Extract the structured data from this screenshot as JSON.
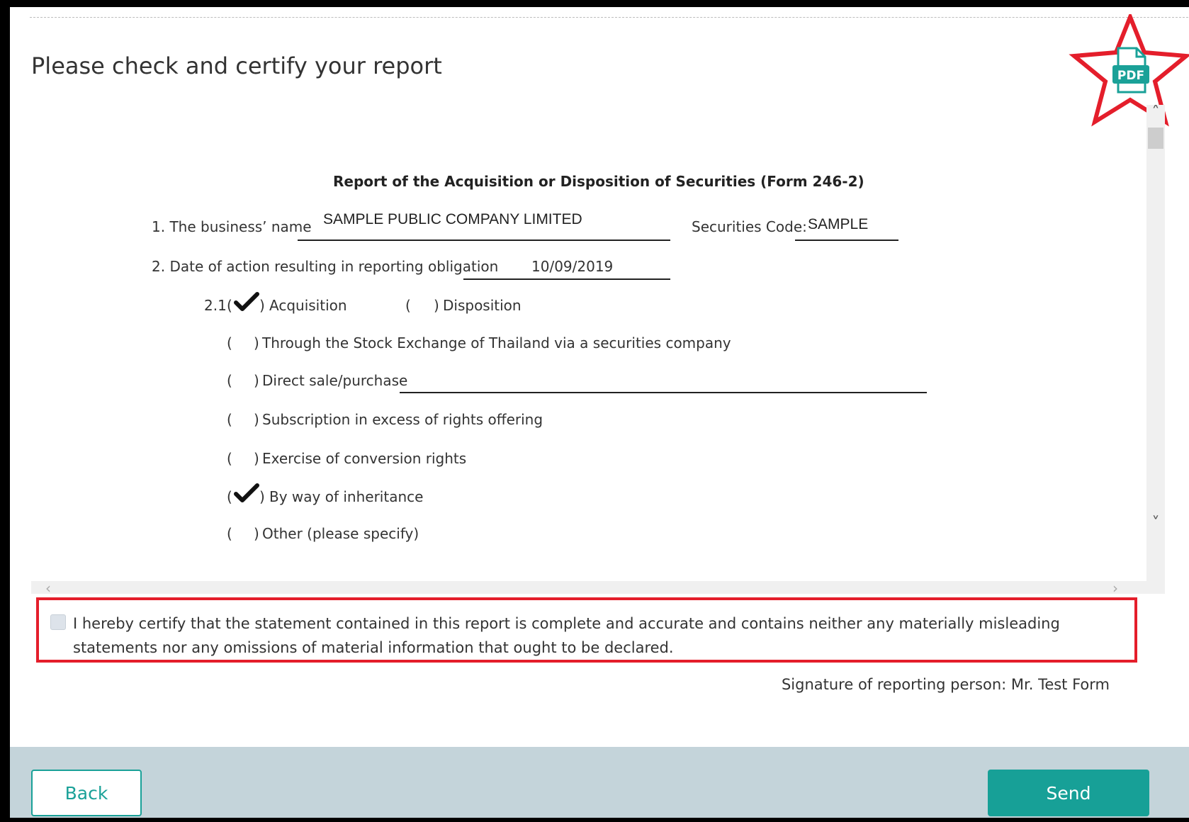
{
  "header": {
    "title": "Please check and certify your report",
    "pdf_label": "PDF",
    "accent_color": "#e41e2b",
    "pdf_icon_color": "#1aa198"
  },
  "report": {
    "title": "Report of the Acquisition or Disposition of Securities (Form 246-2)",
    "business_name_label": "1. The business’ name",
    "business_name_value": "SAMPLE PUBLIC COMPANY LIMITED",
    "securities_code_label": "Securities Code:",
    "securities_code_value": "SAMPLE",
    "date_label": "2. Date of action resulting in reporting obligation",
    "date_value": "10/09/2019",
    "section_number": "2.1",
    "acquisition_label": "Acquisition",
    "disposition_label": "Disposition",
    "acquisition_checked": true,
    "disposition_checked": false,
    "methods": [
      {
        "label": "Through the Stock Exchange of Thailand via a securities company",
        "checked": false
      },
      {
        "label": "Direct sale/purchase",
        "checked": false
      },
      {
        "label": "Subscription in excess of rights offering",
        "checked": false
      },
      {
        "label": "Exercise of conversion rights",
        "checked": false
      },
      {
        "label": "By way of inheritance",
        "checked": true
      },
      {
        "label": "Other (please specify)",
        "checked": false
      }
    ]
  },
  "certification": {
    "text": "I hereby certify that the statement contained in this report is complete and accurate and contains neither any materially misleading statements nor any omissions of material information that ought to be declared.",
    "checked": false
  },
  "signature": {
    "text": "Signature of reporting person: Mr. Test Form"
  },
  "footer": {
    "back_label": "Back",
    "send_label": "Send",
    "send_color": "#17a097"
  }
}
